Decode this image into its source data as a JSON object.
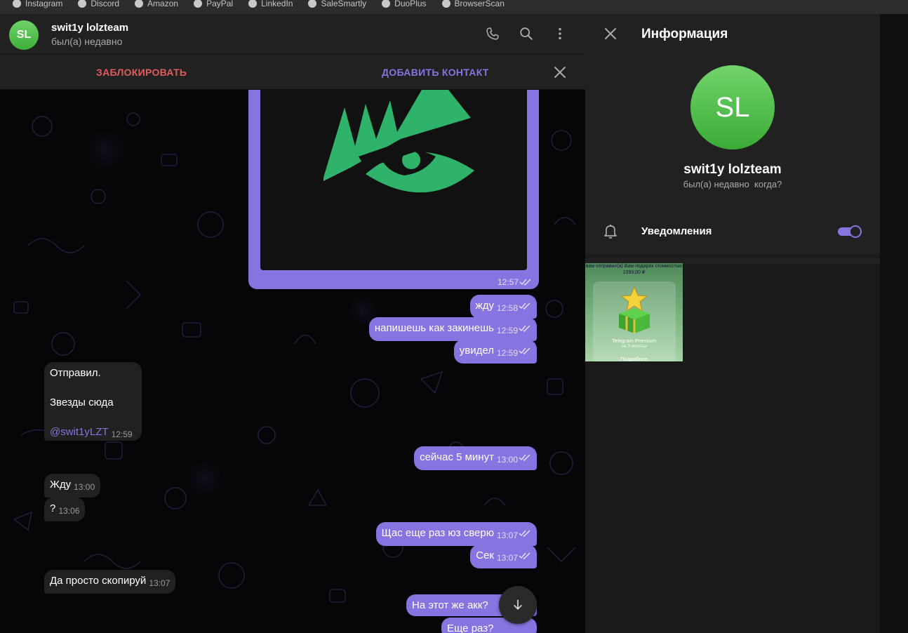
{
  "bookmarks": [
    "Instagram",
    "Discord",
    "Amazon",
    "PayPal",
    "LinkedIn",
    "SaleSmartly",
    "DuoPlus",
    "BrowserScan"
  ],
  "header": {
    "avatar_initials": "SL",
    "name": "swit1y lolzteam",
    "status": "был(а) недавно"
  },
  "action_bar": {
    "block": "ЗАБЛОКИРОВАТЬ",
    "add_contact": "ДОБАВИТЬ КОНТАКТ"
  },
  "messages": {
    "image_time": "12:57",
    "m1": {
      "text": "жду",
      "time": "12:58"
    },
    "m2": {
      "text": "напишешь как закинешь",
      "time": "12:59"
    },
    "m3": {
      "text": "увидел",
      "time": "12:59"
    },
    "m4": {
      "line1": "Отправил.",
      "line2": "Звезды сюда",
      "mention": "@swit1yLZT",
      "time": "12:59"
    },
    "m5": {
      "text": "сейчас 5 минут",
      "time": "13:00"
    },
    "m6": {
      "text": "Жду",
      "time": "13:00"
    },
    "m7": {
      "text": "?",
      "time": "13:06"
    },
    "m8": {
      "text": "Щас еще раз юз сверю",
      "time": "13:07"
    },
    "m9": {
      "text": "Сек",
      "time": "13:07"
    },
    "m10": {
      "text": "Да просто скопируй",
      "time": "13:07"
    },
    "m11": {
      "text": "На этот же акк?"
    },
    "m12": {
      "text": "Еще раз?"
    }
  },
  "info": {
    "title": "Информация",
    "avatar_initials": "SL",
    "name": "swit1y lolzteam",
    "status": "был(а) недавно",
    "status_link": "когда?",
    "notifications_label": "Уведомления",
    "notifications_on": true
  },
  "media": {
    "top_text_1": "вам отправил(а) Вам подарок стоимостью",
    "top_text_2": "1099,00 ₽",
    "title": "Telegram Premium",
    "subtitle": "на 3 месяца",
    "more": "Подробнее"
  },
  "colors": {
    "accent": "#8774e1",
    "danger": "#e05d5d",
    "avatar": "#4cbf47",
    "panel": "#212121",
    "logo_green": "#2fb36b"
  }
}
